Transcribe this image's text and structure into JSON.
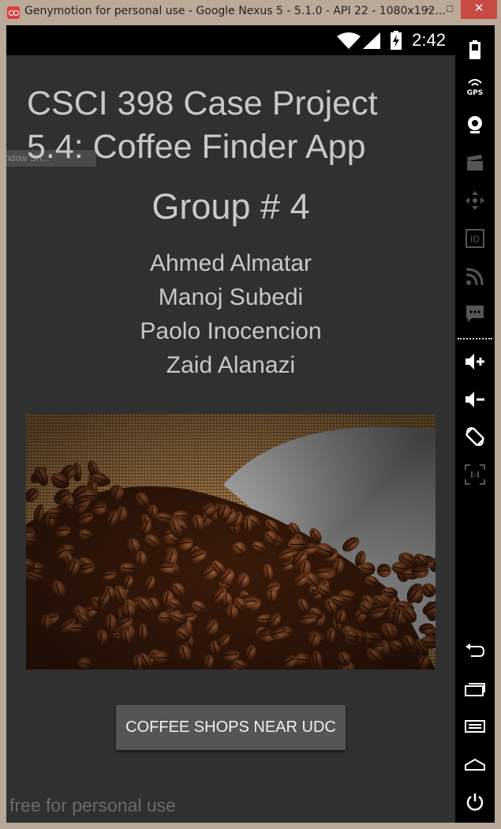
{
  "window": {
    "title": "Genymotion for personal use - Google Nexus 5 - 5.1.0 - API 22 - 1080x192...",
    "minimize": "–",
    "maximize": "□",
    "close": "✕"
  },
  "statusbar": {
    "time": "2:42",
    "icons": [
      "wifi-icon",
      "signal-icon",
      "battery-charging-icon"
    ]
  },
  "toast": "ndow Sh...",
  "app": {
    "title": "CSCI 398 Case Project 5.4: Coffee Finder App",
    "group": "Group # 4",
    "members": [
      "Ahmed Almatar",
      "Manoj Subedi",
      "Paolo Inocencion",
      "Zaid Alanazi"
    ],
    "image": "coffee-beans-photo",
    "button_label": "COFFEE SHOPS NEAR UDC"
  },
  "watermark": "free for personal use",
  "sidebar": {
    "gps_label": "GPS",
    "id_label": "ID",
    "icons": [
      "battery-icon",
      "gps-icon",
      "webcam-icon",
      "clapperboard-icon",
      "dpad-icon",
      "id-icon",
      "rss-icon",
      "sms-icon",
      "volume-up-icon",
      "volume-down-icon",
      "rotate-icon",
      "pixel-perfect-icon",
      "back-icon",
      "recent-apps-icon",
      "menu-icon",
      "home-icon",
      "power-icon"
    ]
  },
  "colors": {
    "window_frame": "#bba99a",
    "close_button": "#c74a43",
    "app_background": "#303030",
    "text": "#c8c8c8",
    "button": "#555555"
  }
}
